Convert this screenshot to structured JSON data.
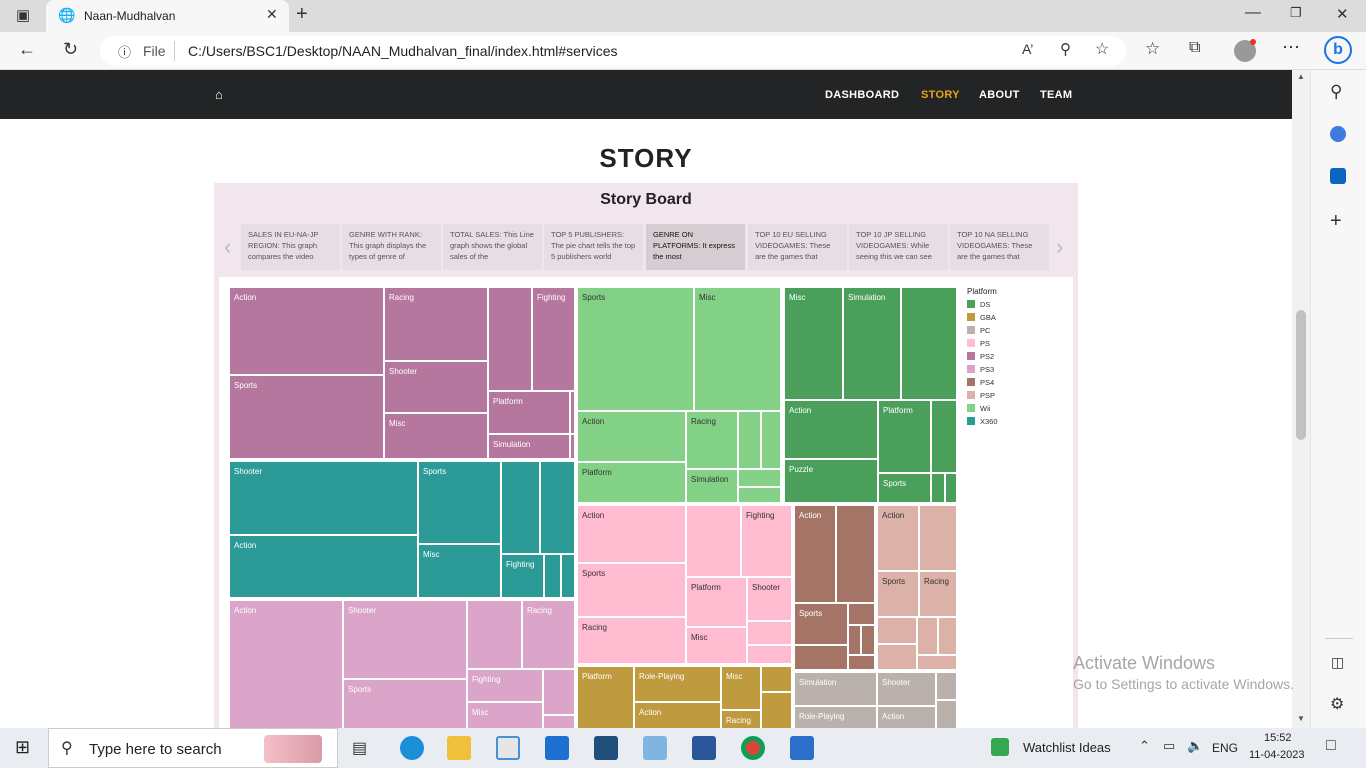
{
  "browser": {
    "tab_title": "Naan-Mudhalvan",
    "file_label": "File",
    "url": "C:/Users/BSC1/Desktop/NAAN_Mudhalvan_final/index.html#services"
  },
  "nav": {
    "links": [
      "DASHBOARD",
      "STORY",
      "ABOUT",
      "TEAM"
    ],
    "active": "STORY",
    "active_color": "#e8a317"
  },
  "page": {
    "title": "STORY",
    "storyboard_title": "Story Board"
  },
  "story_points": [
    "SALES IN EU-NA-JP REGION: This graph compares the video",
    "GENRE WITH RANK: This graph displays the types of genre of",
    "TOTAL SALES: This Line graph shows the global sales of the",
    "TOP 5 PUBLISHERS: The pie chart tells the top 5 publishers world",
    "GENRE ON PLATFORMS: It express the most",
    "TOP 10 EU SELLING VIDEOGAMES: These are the games that",
    "TOP 10 JP SELLING VIDEOGAMES: While seeing this we can see",
    "TOP 10 NA SELLING VIDEOGAMES: These are the games that"
  ],
  "treemap_labels": {
    "ps2": [
      "Action",
      "Racing",
      "Fighting",
      "Sports",
      "Shooter",
      "Platform",
      "Misc",
      "Simulation"
    ],
    "wii": [
      "Sports",
      "Misc",
      "Action",
      "Racing",
      "Platform",
      "Simulation"
    ],
    "ds": [
      "Misc",
      "Simulation",
      "Action",
      "Platform",
      "Puzzle",
      "Sports"
    ],
    "x360": [
      "Shooter",
      "Sports",
      "Action",
      "Misc",
      "Fighting"
    ],
    "ps": [
      "Action",
      "Fighting",
      "Sports",
      "Platform",
      "Shooter",
      "Racing",
      "Misc"
    ],
    "ps4": [
      "Action",
      "Sports"
    ],
    "psp": [
      "Action",
      "Sports",
      "Racing"
    ],
    "ps3": [
      "Action",
      "Shooter",
      "Racing",
      "Sports",
      "Fighting",
      "Misc"
    ],
    "gba": [
      "Platform",
      "Role-Playing",
      "Misc",
      "Action",
      "Racing"
    ],
    "pc": [
      "Simulation",
      "Shooter",
      "Role-Playing",
      "Action"
    ]
  },
  "legend": {
    "title": "Platform",
    "items": [
      {
        "label": "DS",
        "color": "#4aa05a"
      },
      {
        "label": "GBA",
        "color": "#bf9a3e"
      },
      {
        "label": "PC",
        "color": "#bab0ac"
      },
      {
        "label": "PS",
        "color": "#ffbcd0"
      },
      {
        "label": "PS2",
        "color": "#b6779e"
      },
      {
        "label": "PS3",
        "color": "#daa5c9"
      },
      {
        "label": "PS4",
        "color": "#a47567"
      },
      {
        "label": "PSP",
        "color": "#dcb1a7"
      },
      {
        "label": "Wii",
        "color": "#83d087"
      },
      {
        "label": "X360",
        "color": "#2c9a96"
      }
    ]
  },
  "watermark": {
    "line1": "Activate Windows",
    "line2": "Go to Settings to activate Windows."
  },
  "taskbar": {
    "search_placeholder": "Type here to search",
    "widget": "Watchlist Ideas",
    "lang": "ENG",
    "time": "15:52",
    "date": "11-04-2023"
  }
}
